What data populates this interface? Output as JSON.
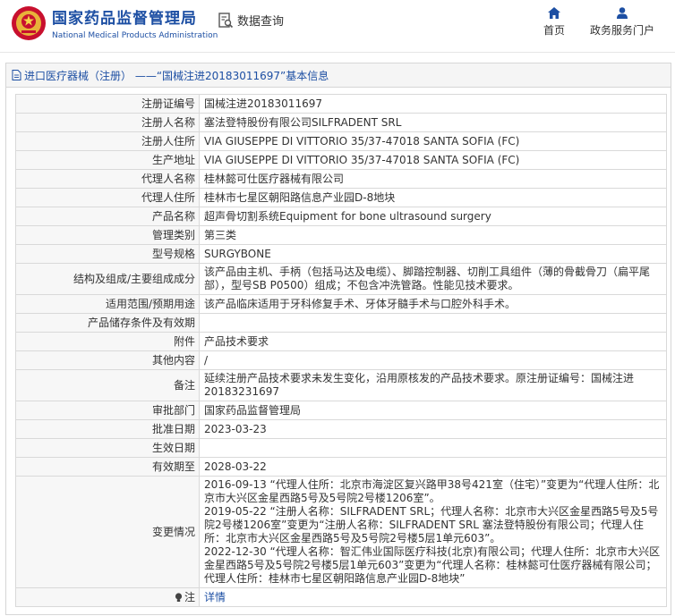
{
  "header": {
    "brand_cn": "国家药品监督管理局",
    "brand_en": "National Medical Products Administration",
    "search_label": "数据查询",
    "nav": [
      {
        "label": "首页",
        "icon": "home-icon"
      },
      {
        "label": "政务服务门户",
        "icon": "user-icon"
      }
    ]
  },
  "panel": {
    "title": "进口医疗器械（注册） ——“国械注进20183011697”基本信息"
  },
  "rows": [
    {
      "label": "注册证编号",
      "value": "国械注进20183011697"
    },
    {
      "label": "注册人名称",
      "value": "塞法登特股份有限公司SILFRADENT SRL"
    },
    {
      "label": "注册人住所",
      "value": "VIA GIUSEPPE DI VITTORIO 35/37-47018 SANTA SOFIA (FC)"
    },
    {
      "label": "生产地址",
      "value": "VIA GIUSEPPE DI VITTORIO 35/37-47018 SANTA SOFIA (FC)"
    },
    {
      "label": "代理人名称",
      "value": "桂林懿可仕医疗器械有限公司"
    },
    {
      "label": "代理人住所",
      "value": "桂林市七星区朝阳路信息产业园D-8地块"
    },
    {
      "label": "产品名称",
      "value": "超声骨切割系统Equipment for bone ultrasound surgery"
    },
    {
      "label": "管理类别",
      "value": "第三类"
    },
    {
      "label": "型号规格",
      "value": "SURGYBONE"
    },
    {
      "label": "结构及组成/主要组成成分",
      "value": "该产品由主机、手柄（包括马达及电缆）、脚踏控制器、切削工具组件（薄的骨截骨刀（扁平尾部），型号SB P0500）组成；不包含冲洗管路。性能见技术要求。"
    },
    {
      "label": "适用范围/预期用途",
      "value": "该产品临床适用于牙科修复手术、牙体牙髓手术与口腔外科手术。"
    },
    {
      "label": "产品储存条件及有效期",
      "value": ""
    },
    {
      "label": "附件",
      "value": "产品技术要求"
    },
    {
      "label": "其他内容",
      "value": "/"
    },
    {
      "label": "备注",
      "value": "延续注册产品技术要求未发生变化，沿用原核发的产品技术要求。原注册证编号：国械注进20183231697"
    },
    {
      "label": "审批部门",
      "value": "国家药品监督管理局"
    },
    {
      "label": "批准日期",
      "value": "2023-03-23"
    },
    {
      "label": "生效日期",
      "value": ""
    },
    {
      "label": "有效期至",
      "value": "2028-03-22"
    },
    {
      "label": "变更情况",
      "value": "2016-09-13 “代理人住所：北京市海淀区复兴路甲38号421室（住宅）”变更为“代理人住所：北京市大兴区金星西路5号及5号院2号楼1206室”。\n2019-05-22 “注册人名称：SILFRADENT SRL；代理人名称：北京市大兴区金星西路5号及5号院2号楼1206室”变更为“注册人名称：SILFRADENT SRL 塞法登特股份有限公司；代理人住所：北京市大兴区金星西路5号及5号院2号楼5层1单元603”。\n2022-12-30 “代理人名称：智汇伟业国际医疗科技(北京)有限公司；代理人住所：北京市大兴区金星西路5号及5号院2号楼5层1单元603”变更为“代理人名称：桂林懿可仕医疗器械有限公司；代理人住所：桂林市七星区朝阳路信息产业园D-8地块”"
    },
    {
      "label": "注",
      "value": "详情"
    }
  ]
}
